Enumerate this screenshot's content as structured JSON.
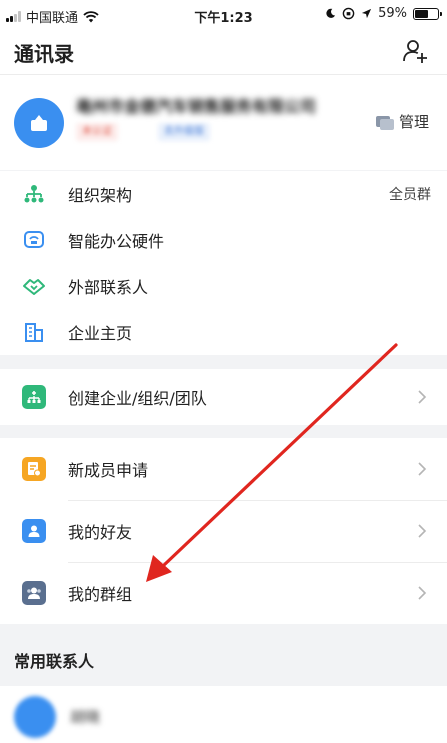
{
  "status_bar": {
    "carrier": "中国联通",
    "time": "下午1:23",
    "battery": "59%",
    "battery_level": 0.59
  },
  "header": {
    "title": "通讯录"
  },
  "company": {
    "name": "亳州市金德汽车销售服务有限公司",
    "badge_status": "未认证",
    "badge_action": "去升级版",
    "manage_label": "管理"
  },
  "org_menu": [
    {
      "label": "组织架构",
      "right": "全员群"
    },
    {
      "label": "智能办公硬件"
    },
    {
      "label": "外部联系人"
    },
    {
      "label": "企业主页"
    }
  ],
  "create_menu": {
    "label": "创建企业/组织/团队"
  },
  "personal_menu": [
    {
      "label": "新成员申请"
    },
    {
      "label": "我的好友"
    },
    {
      "label": "我的群组"
    }
  ],
  "frequent": {
    "title": "常用联系人",
    "contacts": [
      {
        "name": "胡晓"
      }
    ]
  },
  "colors": {
    "accent_green": "#2fb87a",
    "accent_blue": "#3a8ff0",
    "tile_orange": "#f6a623",
    "tile_slate": "#5a6f8f",
    "arrow_red": "#e0261f"
  }
}
